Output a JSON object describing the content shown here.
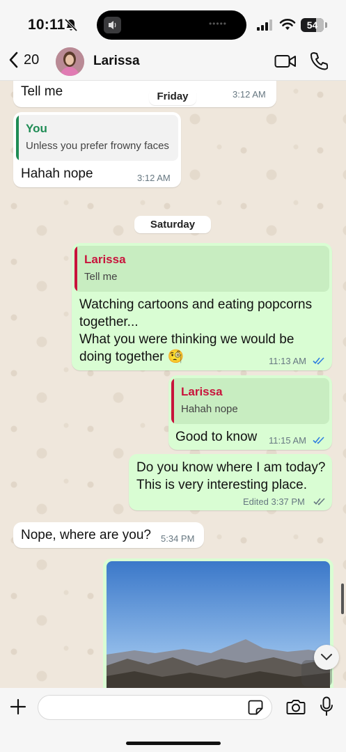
{
  "status_bar": {
    "time": "10:11",
    "battery": "54"
  },
  "header": {
    "back_count": "20",
    "contact_name": "Larissa"
  },
  "messages": {
    "m1": {
      "text": "Tell me",
      "time": "3:12 AM"
    },
    "date_friday": "Friday",
    "m2": {
      "quote_author": "You",
      "quote_text": "Unless you prefer frowny faces",
      "text": "Hahah nope",
      "time": "3:12 AM"
    },
    "date_saturday": "Saturday",
    "m3": {
      "quote_author": "Larissa",
      "quote_text": "Tell me",
      "line1": "Watching cartoons and eating popcorns",
      "line2": "together...",
      "line3": "What you were thinking we would be",
      "line4": "doing together 🧐",
      "time": "11:13 AM"
    },
    "m4": {
      "quote_author": "Larissa",
      "quote_text": "Hahah nope",
      "text": "Good to know",
      "time": "11:15 AM"
    },
    "m5": {
      "line1": "Do you know where I am today?",
      "line2": "This is very interesting place.",
      "time": "Edited 3:37 PM"
    },
    "m6": {
      "text": "Nope, where are you?",
      "time": "5:34 PM"
    }
  },
  "composer": {
    "input_value": "",
    "input_placeholder": ""
  },
  "colors": {
    "outgoing_bubble": "#d9fdd3",
    "incoming_bubble": "#ffffff",
    "you_quote_accent": "#1f8c55",
    "larissa_quote_accent": "#c8143c",
    "read_tick": "#2f7ee0"
  },
  "icons": [
    "bell-slash-icon",
    "signal-icon",
    "wifi-icon",
    "battery-icon",
    "chevron-left-icon",
    "video-camera-icon",
    "phone-icon",
    "double-check-icon",
    "chevron-down-icon",
    "plus-icon",
    "sticker-icon",
    "camera-icon",
    "microphone-icon"
  ]
}
